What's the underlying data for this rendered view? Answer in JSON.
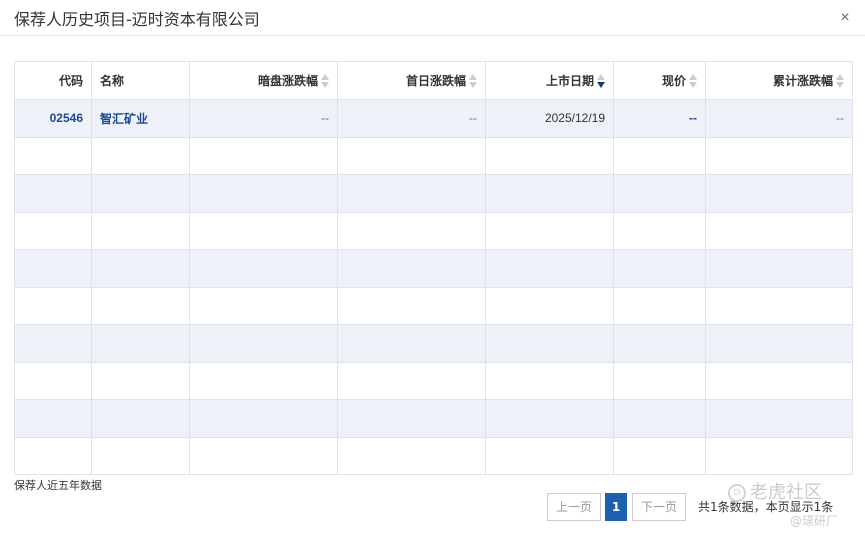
{
  "dialog": {
    "title": "保荐人历史项目-迈时资本有限公司",
    "close_glyph": "×"
  },
  "table": {
    "columns": [
      {
        "label": "代码",
        "sortable": false
      },
      {
        "label": "名称",
        "sortable": false
      },
      {
        "label": "暗盘涨跌幅",
        "sortable": true
      },
      {
        "label": "首日涨跌幅",
        "sortable": true
      },
      {
        "label": "上市日期",
        "sortable": true,
        "active_sort": "desc"
      },
      {
        "label": "现价",
        "sortable": true
      },
      {
        "label": "累计涨跌幅",
        "sortable": true
      }
    ],
    "rows": [
      {
        "code": "02546",
        "name": "智汇矿业",
        "dark_change": "--",
        "first_day_change": "--",
        "listing_date": "2025/12/19",
        "price": "--",
        "cumulative_change": "--"
      }
    ],
    "empty_row_count": 9
  },
  "footnote": "保荐人近五年数据",
  "pagination": {
    "prev_label": "上一页",
    "current_page": "1",
    "next_label": "下一页",
    "info": "共1条数据，本页显示1条"
  },
  "watermark": {
    "main": "老虎社区",
    "sub": "@瑹研厂"
  },
  "colors": {
    "accent": "#1f5fb0",
    "link": "#1a4a8e",
    "stripe": "#eef2f8",
    "border": "#dde3ea"
  }
}
